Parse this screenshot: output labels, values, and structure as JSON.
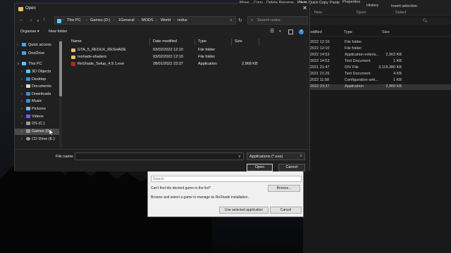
{
  "dialog": {
    "title": "Open",
    "address": [
      "This PC",
      "Games (D:)",
      "1General",
      "MODS",
      "World",
      "redux"
    ],
    "search_placeholder": "Search redux",
    "toolbar": {
      "organize": "Organise ▾",
      "new_folder": "New folder"
    },
    "columns": [
      "Name",
      "Date modified",
      "Type",
      "Size"
    ],
    "files": [
      {
        "name": "GTA_5_REDUX_RESHADE",
        "date": "03/02/2022 12:10",
        "type": "File folder",
        "size": "",
        "icon": "folder-icon"
      },
      {
        "name": "reshade-shaders",
        "date": "03/02/2022 12:10",
        "type": "File folder",
        "size": "",
        "icon": "folder-icon"
      },
      {
        "name": "ReShade_Setup_4.9.1.exe",
        "date": "28/01/2022 23:37",
        "type": "Application",
        "size": "2,968 KB",
        "icon": "application-icon"
      }
    ],
    "nav": [
      {
        "label": "Quick access",
        "icon": "star-icon",
        "color": "#4aa3ff"
      },
      {
        "label": "OneDrive",
        "icon": "cloud-icon",
        "color": "#4aa3ff"
      },
      {
        "label": "This PC",
        "icon": "computer-icon",
        "color": "#5cc8ff"
      },
      {
        "label": "3D Objects",
        "icon": "cube-icon",
        "color": "#5cc8ff"
      },
      {
        "label": "Desktop",
        "icon": "desktop-icon",
        "color": "#3c8ddb"
      },
      {
        "label": "Documents",
        "icon": "documents-icon",
        "color": "#d9d9d9"
      },
      {
        "label": "Downloads",
        "icon": "download-icon",
        "color": "#3c8ddb"
      },
      {
        "label": "Music",
        "icon": "music-icon",
        "color": "#3c8ddb"
      },
      {
        "label": "Pictures",
        "icon": "pictures-icon",
        "color": "#5cc8ff"
      },
      {
        "label": "Videos",
        "icon": "videos-icon",
        "color": "#7a5cff"
      },
      {
        "label": "OS (C:)",
        "icon": "drive-icon",
        "color": "#9a9a9a"
      },
      {
        "label": "Games (D:)",
        "icon": "drive-icon",
        "color": "#9a9a9a"
      },
      {
        "label": "CD Drive (E:)",
        "icon": "cd-icon",
        "color": "#9a9a9a"
      }
    ],
    "file_name_label": "File name:",
    "file_name_value": "",
    "file_type": "Applications (*.exe)",
    "open_label": "Open",
    "cancel_label": "Cancel"
  },
  "background_explorer": {
    "ribbon": [
      "Pin to Quick",
      "Copy",
      "Paste",
      "Move",
      "Copy",
      "Delete",
      "Rename",
      "New",
      "Properties",
      "History",
      "Invert selection"
    ],
    "ribbon_groups": [
      "New",
      "Open",
      "Select"
    ],
    "columns": [
      "Modified",
      "Type",
      "Size"
    ],
    "rows": [
      {
        "date": "2022 12:10",
        "type": "File folder",
        "size": ""
      },
      {
        "date": "2022 12:10",
        "type": "File folder",
        "size": ""
      },
      {
        "date": "2022 14:53",
        "type": "Application extens...",
        "size": "2,903 KB"
      },
      {
        "date": "2022 14:53",
        "type": "Text Document",
        "size": "1 KB"
      },
      {
        "date": "2021 21:47",
        "type": "OIV File",
        "size": "3,118,380 KB"
      },
      {
        "date": "2021 21:25",
        "type": "Text Document",
        "size": "4 KB"
      },
      {
        "date": "2022 11:58",
        "type": "Configuration sett...",
        "size": "1 KB"
      },
      {
        "date": "2022 23:37",
        "type": "Application",
        "size": "2,968 KB"
      }
    ]
  },
  "reshade": {
    "search_placeholder": "Search",
    "cant_find": "Can't find the desired game in the list?",
    "browse_label": "Browse...",
    "instruction": "Browse and select a game to manage its ReShade installation.",
    "use_selected_label": "Use selected application",
    "cancel_label": "Cancel"
  }
}
